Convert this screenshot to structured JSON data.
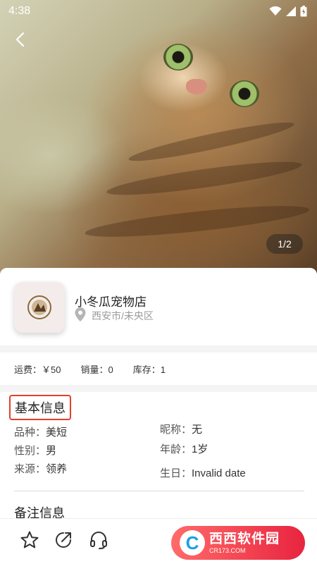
{
  "status_bar": {
    "time": "4:38",
    "icons": [
      "wifi-icon",
      "signal-icon",
      "battery-icon"
    ]
  },
  "gallery": {
    "counter": "1/2"
  },
  "store": {
    "name": "小冬瓜宠物店",
    "location": "西安市/未央区"
  },
  "stats": {
    "shipping": "运费：￥50",
    "sales": "销量：0",
    "stock": "库存：1"
  },
  "basic_info": {
    "title": "基本信息",
    "breed_label": "品种：",
    "breed": "美短",
    "gender_label": "性别：",
    "gender": "男",
    "source_label": "来源：",
    "source": "领养",
    "nickname_label": "昵称：",
    "nickname": "无",
    "age_label": "年龄：",
    "age": "1岁",
    "birthday_label": "生日：",
    "birthday": "Invalid date"
  },
  "remarks": {
    "title": "备注信息"
  },
  "bottom_bar": {
    "icons": [
      "star-icon",
      "share-icon",
      "headset-icon"
    ]
  },
  "watermark": {
    "logo_letter": "C",
    "name": "西西软件园",
    "url": "CR173.COM"
  },
  "colors": {
    "highlight_border": "#e0412b",
    "watermark_red": "#e8243f",
    "muted_text": "#9a9a9a"
  }
}
